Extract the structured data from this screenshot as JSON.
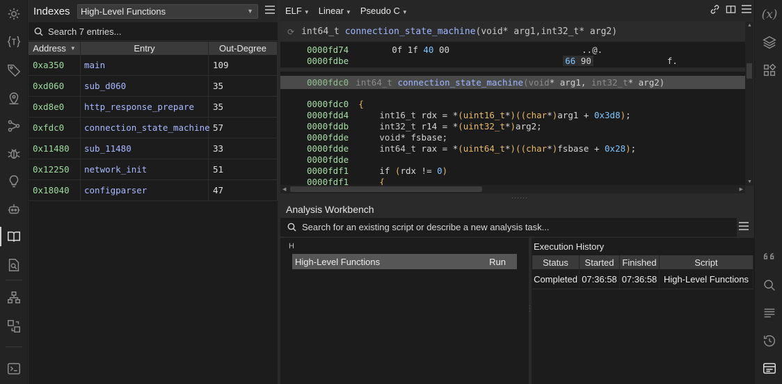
{
  "indexes": {
    "title": "Indexes",
    "selector": "High-Level Functions",
    "search_placeholder": "Search 7 entries...",
    "columns": [
      "Address",
      "Entry",
      "Out-Degree"
    ],
    "rows": [
      {
        "address": "0xa350",
        "entry": "main",
        "out": "109"
      },
      {
        "address": "0xd060",
        "entry": "sub_d060",
        "out": "35"
      },
      {
        "address": "0xd8e0",
        "entry": "http_response_prepare",
        "out": "35"
      },
      {
        "address": "0xfdc0",
        "entry": "connection_state_machine",
        "out": "57"
      },
      {
        "address": "0x11480",
        "entry": "sub_11480",
        "out": "33"
      },
      {
        "address": "0x12250",
        "entry": "network_init",
        "out": "51"
      },
      {
        "address": "0x18040",
        "entry": "configparser",
        "out": "47"
      }
    ]
  },
  "code": {
    "view_dropdowns": [
      "ELF",
      "Linear",
      "Pseudo C"
    ],
    "signature": {
      "ret": "int64_t",
      "name": "connection_state_machine",
      "p1t": "void",
      "p1": "* arg1, ",
      "p2t": "int32_t",
      "p2": "* arg2)"
    },
    "hex": [
      {
        "addr": "0000fd74",
        "bytes": "0f 1f 40 00",
        "ascii": "..@."
      },
      {
        "addr": "0000fdbe",
        "bytes": "66 90",
        "ascii": "f."
      }
    ],
    "hl": {
      "addr": "0000fdc0",
      "ret": "int64_t",
      "name": "connection_state_machine",
      "open": "(",
      "p1t": "void",
      "p1": "* arg1, ",
      "p2t": "int32_t",
      "p2": "* arg2)"
    },
    "lines": [
      {
        "addr": "0000fdc0",
        "text": "{"
      },
      {
        "addr": "0000fdd4",
        "text": "    int16_t rdx = *(uint16_t*)((char*)arg1 + 0x3d8);"
      },
      {
        "addr": "0000fddb",
        "text": "    int32_t r14 = *(uint32_t*)arg2;"
      },
      {
        "addr": "0000fdde",
        "text": "    void* fsbase;"
      },
      {
        "addr": "0000fdde",
        "text": "    int64_t rax = *(uint64_t*)((char*)fsbase + 0x28);"
      },
      {
        "addr": "0000fdde",
        "text": ""
      },
      {
        "addr": "0000fdf1",
        "text": "    if (rdx != 0)"
      },
      {
        "addr": "0000fdf1",
        "text": "    {"
      }
    ]
  },
  "workbench": {
    "title": "Analysis Workbench",
    "search_placeholder": "Search for an existing script or describe a new analysis task...",
    "group_label": "H",
    "script_name": "High-Level Functions",
    "run_label": "Run",
    "history": {
      "title": "Execution History",
      "columns": [
        "Status",
        "Started",
        "Finished",
        "Script"
      ],
      "rows": [
        {
          "status": "Completed",
          "started": "07:36:58",
          "finished": "07:36:58",
          "script": "High-Level Functions"
        }
      ]
    }
  },
  "right_bar": {
    "variables_label": "(x)"
  }
}
